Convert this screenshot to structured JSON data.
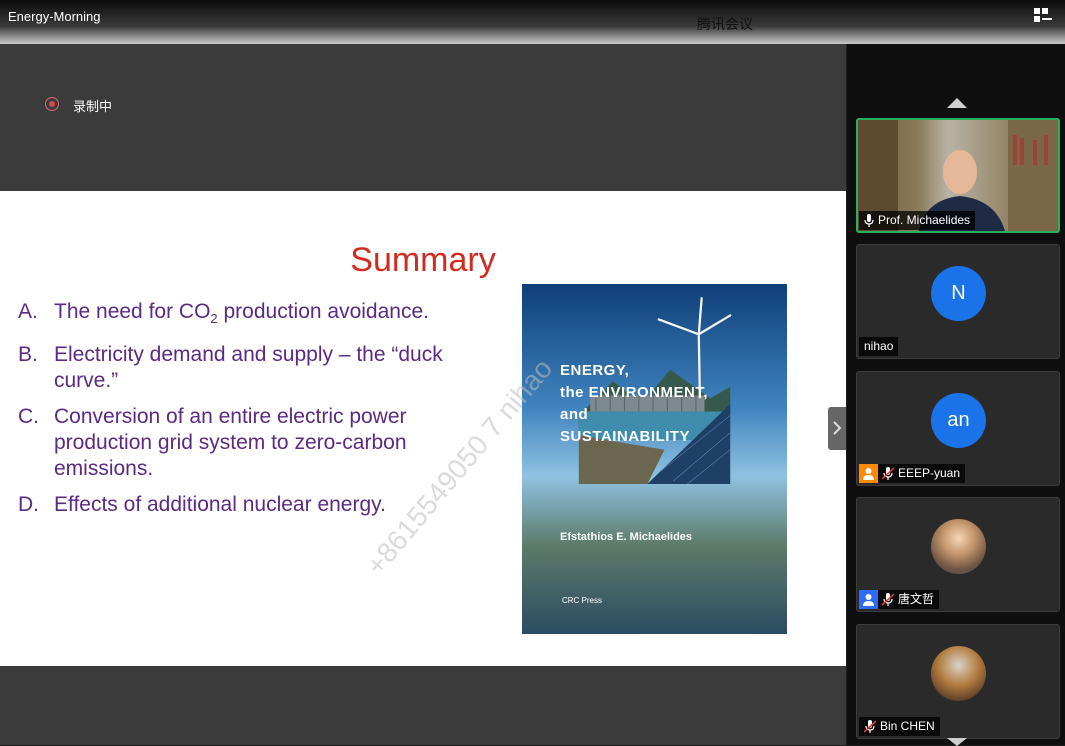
{
  "window": {
    "title": "Energy-Morning",
    "app_name": "腾讯会议"
  },
  "recording": {
    "label": "录制中"
  },
  "slide": {
    "title": "Summary",
    "items": [
      {
        "letter": "A.",
        "text_before": "The need for CO",
        "subscript": "2",
        "text_after": " production avoidance."
      },
      {
        "letter": "B.",
        "text": "Electricity demand and supply – the “duck curve.”"
      },
      {
        "letter": "C.",
        "text": "Conversion of an entire electric power production grid system to zero-carbon emissions."
      },
      {
        "letter": "D.",
        "text": "Effects of additional nuclear energy."
      }
    ],
    "book": {
      "title": "ENERGY,\nthe ENVIRONMENT,\nand\nSUSTAINABILITY",
      "author": "Efstathios E. Michaelides",
      "publisher": "CRC Press"
    },
    "watermark": "+8615549050 7 nihao"
  },
  "participants": [
    {
      "name": "Prof. Michaelides",
      "type": "video",
      "active": true,
      "mic": "on"
    },
    {
      "name": "nihao",
      "type": "initial",
      "initial": "N"
    },
    {
      "name": "EEEP-yuan",
      "type": "initial",
      "initial": "an",
      "badge": "host",
      "mic": "muted"
    },
    {
      "name": "唐文哲",
      "type": "photo",
      "badge": "cohost",
      "mic": "muted"
    },
    {
      "name": "Bin CHEN",
      "type": "photo",
      "mic": "muted"
    }
  ],
  "colors": {
    "slide_title": "#d12a1e",
    "slide_text": "#5b2a82",
    "active_border": "#27b05f",
    "avatar_bg": "#1a73e8",
    "host_badge": "#ff8a00",
    "cohost_badge": "#2d6bff"
  }
}
